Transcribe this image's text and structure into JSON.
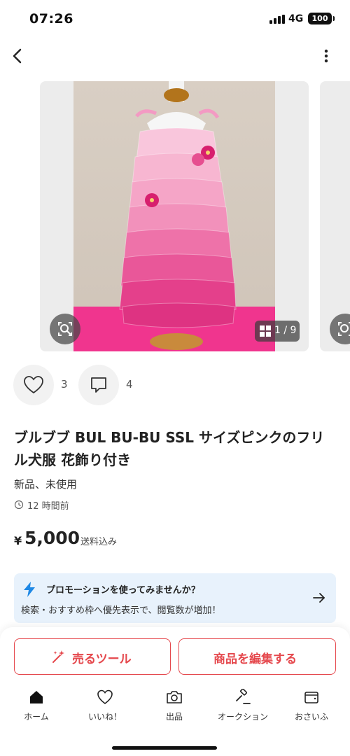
{
  "status_bar": {
    "time": "07:26",
    "network": "4G",
    "battery": "100"
  },
  "navigation": {
    "back_icon": "chevron-left-icon",
    "more_icon": "vertical-dots-icon"
  },
  "gallery": {
    "image_alt": "pink ruffled dog dress on mannequin",
    "counter": "1 / 9",
    "lens_icon": "image-search-icon",
    "grid_icon": "grid-icon"
  },
  "reactions": {
    "likes": "3",
    "comments": "4"
  },
  "item": {
    "title": "ブルブブ BUL BU-BU SSL サイズピンクのフリル犬服 花飾り付き",
    "condition": "新品、未使用",
    "posted": "12 時間前",
    "currency": "¥",
    "price": "5,000",
    "shipping": "送料込み"
  },
  "promo": {
    "title": "プロモーションを使ってみませんか？",
    "description": "検索・おすすめ枠へ優先表示で、閲覧数が増加！"
  },
  "actions": {
    "sell_tool": "売るツール",
    "edit_item": "商品を編集する"
  },
  "tabs": [
    {
      "label": "ホーム",
      "icon": "home-icon"
    },
    {
      "label": "いいね！",
      "icon": "heart-icon"
    },
    {
      "label": "出品",
      "icon": "camera-icon"
    },
    {
      "label": "オークション",
      "icon": "gavel-icon"
    },
    {
      "label": "おさいふ",
      "icon": "wallet-icon"
    }
  ],
  "colors": {
    "accent": "#e5484d",
    "promo_bg": "#e8f2fc",
    "promo_icon": "#1e88e5"
  }
}
